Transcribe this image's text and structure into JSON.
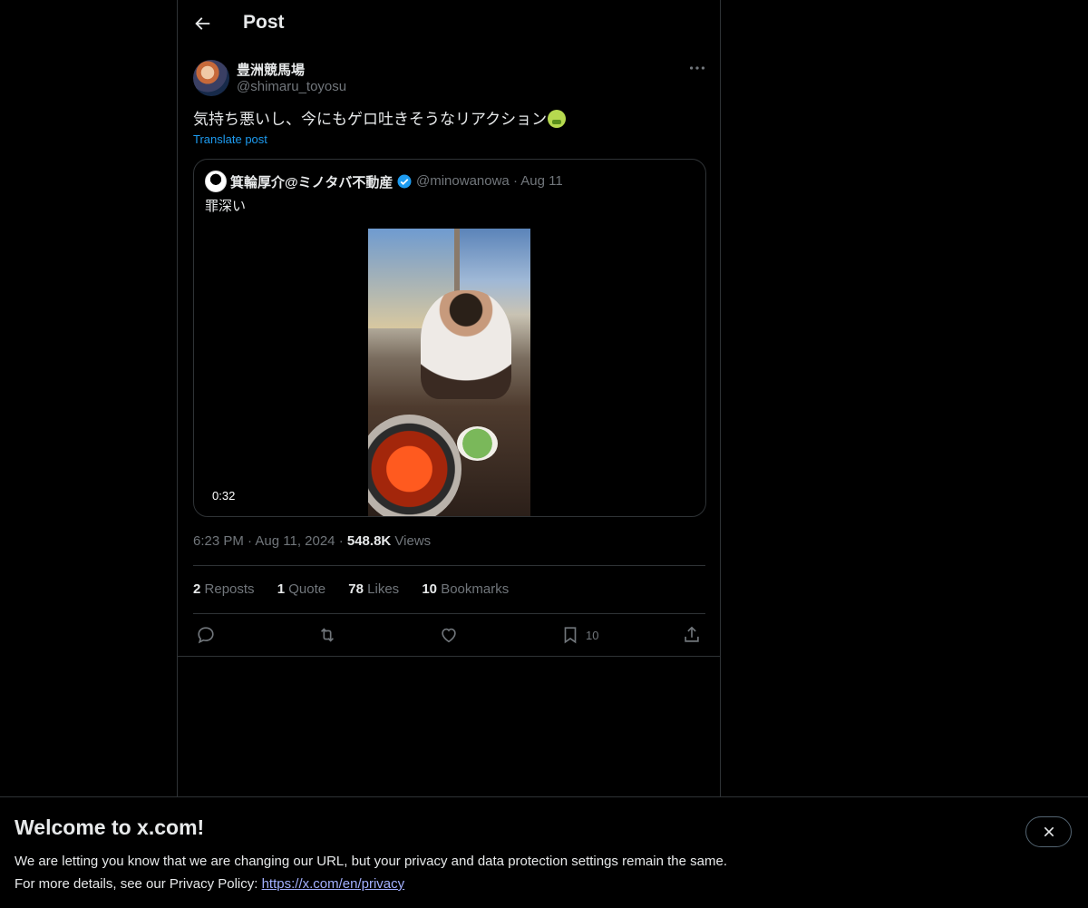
{
  "header": {
    "title": "Post"
  },
  "post": {
    "display_name": "豊洲競馬場",
    "handle": "@shimaru_toyosu",
    "text": "気持ち悪いし、今にもゲロ吐きそうなリアクション",
    "translate_label": "Translate post",
    "time": "6:23 PM",
    "date": "Aug 11, 2024",
    "views_count": "548.8K",
    "views_label": "Views"
  },
  "quote": {
    "display_name": "箕輪厚介@ミノタバ不動産",
    "handle": "@minowanowa",
    "date": "Aug 11",
    "text": "罪深い",
    "video_duration": "0:32"
  },
  "stats": {
    "reposts_count": "2",
    "reposts_label": "Reposts",
    "quotes_count": "1",
    "quotes_label": "Quote",
    "likes_count": "78",
    "likes_label": "Likes",
    "bookmarks_count": "10",
    "bookmarks_label": "Bookmarks"
  },
  "actions": {
    "bookmark_count": "10"
  },
  "banner": {
    "title": "Welcome to x.com!",
    "line1": "We are letting you know that we are changing our URL, but your privacy and data protection settings remain the same.",
    "line2_prefix": "For more details, see our Privacy Policy: ",
    "link": "https://x.com/en/privacy"
  },
  "colors": {
    "accent": "#1d9bf0",
    "muted": "#71767b",
    "border": "#2f3336",
    "background": "#000000"
  }
}
